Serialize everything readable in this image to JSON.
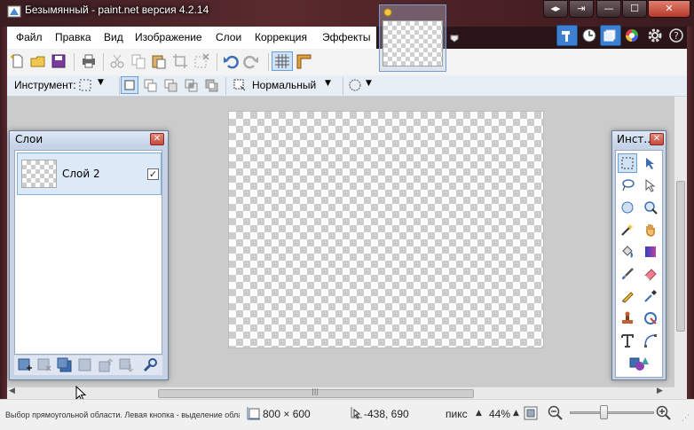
{
  "window": {
    "title": "Безымянный - paint.net версия 4.2.14"
  },
  "menu": {
    "items": [
      "Файл",
      "Правка",
      "Вид",
      "Изображение",
      "Слои",
      "Коррекция",
      "Эффекты"
    ]
  },
  "toolbar": {
    "tool_label": "Инструмент:",
    "blend_mode": "Нормальный"
  },
  "layers_panel": {
    "title": "Слои",
    "layers": [
      {
        "name": "Слой 2",
        "visible": true
      }
    ]
  },
  "tools_panel": {
    "title": "Инст...",
    "tools": [
      "rectangle-select-icon",
      "move-selection-icon",
      "lasso-select-icon",
      "move-selected-icon",
      "ellipse-select-icon",
      "zoom-icon",
      "magic-wand-icon",
      "pan-hand-icon",
      "paint-bucket-icon",
      "gradient-icon",
      "paintbrush-icon",
      "eraser-icon",
      "pencil-icon",
      "color-picker-icon",
      "clone-stamp-icon",
      "recolor-icon",
      "text-icon",
      "line-curve-icon",
      "shapes-icon"
    ]
  },
  "status": {
    "hint": "Выбор прямоугольной области. Левая кнопка - выделение области. Квадр...",
    "image_size": "800 × 600",
    "cursor_pos": "-438, 690",
    "units": "пикс",
    "zoom": "44%"
  },
  "colors": {
    "accent": "#3d7fd0",
    "close_red": "#c24a3c",
    "canvas_bg": "#cbcbcb"
  }
}
